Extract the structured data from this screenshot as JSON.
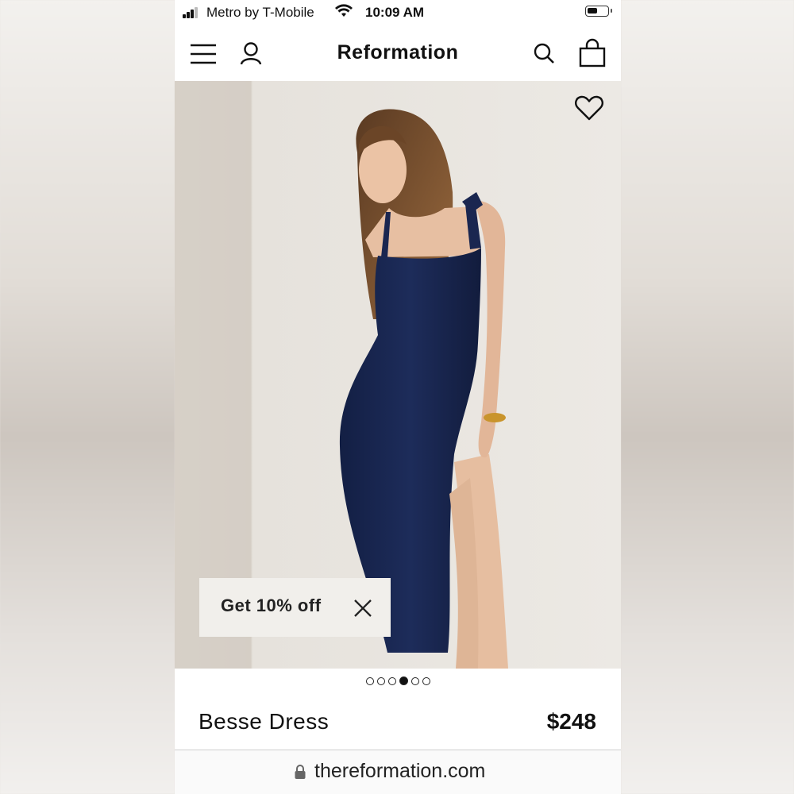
{
  "status_bar": {
    "carrier": "Metro by T-Mobile",
    "time": "10:09 AM",
    "signal_icon": "signal-bars-icon",
    "wifi_icon": "wifi-icon",
    "battery_icon": "battery-icon"
  },
  "header": {
    "brand": "Reformation",
    "icons": [
      "menu-icon",
      "account-icon",
      "search-icon",
      "shopping-bag-icon"
    ]
  },
  "product": {
    "name": "Besse Dress",
    "price": "$248",
    "image_count": 6,
    "active_image": 4,
    "favorite_icon": "heart-icon"
  },
  "promo": {
    "text": "Get 10% off",
    "close_icon": "close-icon"
  },
  "browser": {
    "url": "thereformation.com",
    "lock_icon": "lock-icon"
  },
  "colors": {
    "background": "#ffffff",
    "text": "#111111",
    "dress": "#1b2a55",
    "promo_bg": "#f1efeb"
  }
}
